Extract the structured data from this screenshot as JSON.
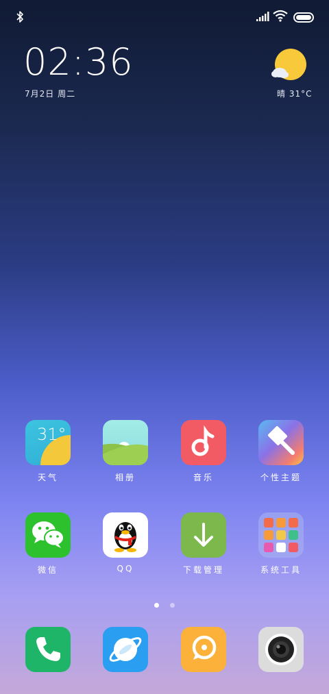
{
  "status_bar": {
    "bluetooth_icon": "bluetooth-icon",
    "signal_icon": "cellular-signal-icon",
    "wifi_icon": "wifi-icon",
    "battery_icon": "battery-icon"
  },
  "lockscreen_widget": {
    "time": "02:36",
    "date": "7月2日 周二",
    "weather_icon": "sun-cloud-icon",
    "weather": "晴 31°C"
  },
  "home_apps": [
    {
      "label": "天气",
      "icon": "weather-app-icon",
      "icon_text": "31°"
    },
    {
      "label": "相册",
      "icon": "gallery-app-icon"
    },
    {
      "label": "音乐",
      "icon": "music-app-icon"
    },
    {
      "label": "个性主题",
      "icon": "themes-app-icon"
    },
    {
      "label": "微信",
      "icon": "wechat-app-icon"
    },
    {
      "label": "QQ",
      "icon": "qq-app-icon"
    },
    {
      "label": "下载管理",
      "icon": "download-manager-icon"
    },
    {
      "label": "系统工具",
      "icon": "system-tools-folder-icon"
    }
  ],
  "page_indicator": {
    "pages": 2,
    "active": 1
  },
  "dock": [
    {
      "icon": "phone-app-icon"
    },
    {
      "icon": "browser-app-icon"
    },
    {
      "icon": "messages-app-icon"
    },
    {
      "icon": "camera-app-icon"
    }
  ],
  "colors": {
    "weather": "#f3c93b",
    "music": "#f25b63",
    "wechat": "#2dc12d",
    "download": "#7db84c",
    "phone": "#1fb568",
    "browser": "#2a9ef0",
    "messages": "#fbb13a"
  }
}
